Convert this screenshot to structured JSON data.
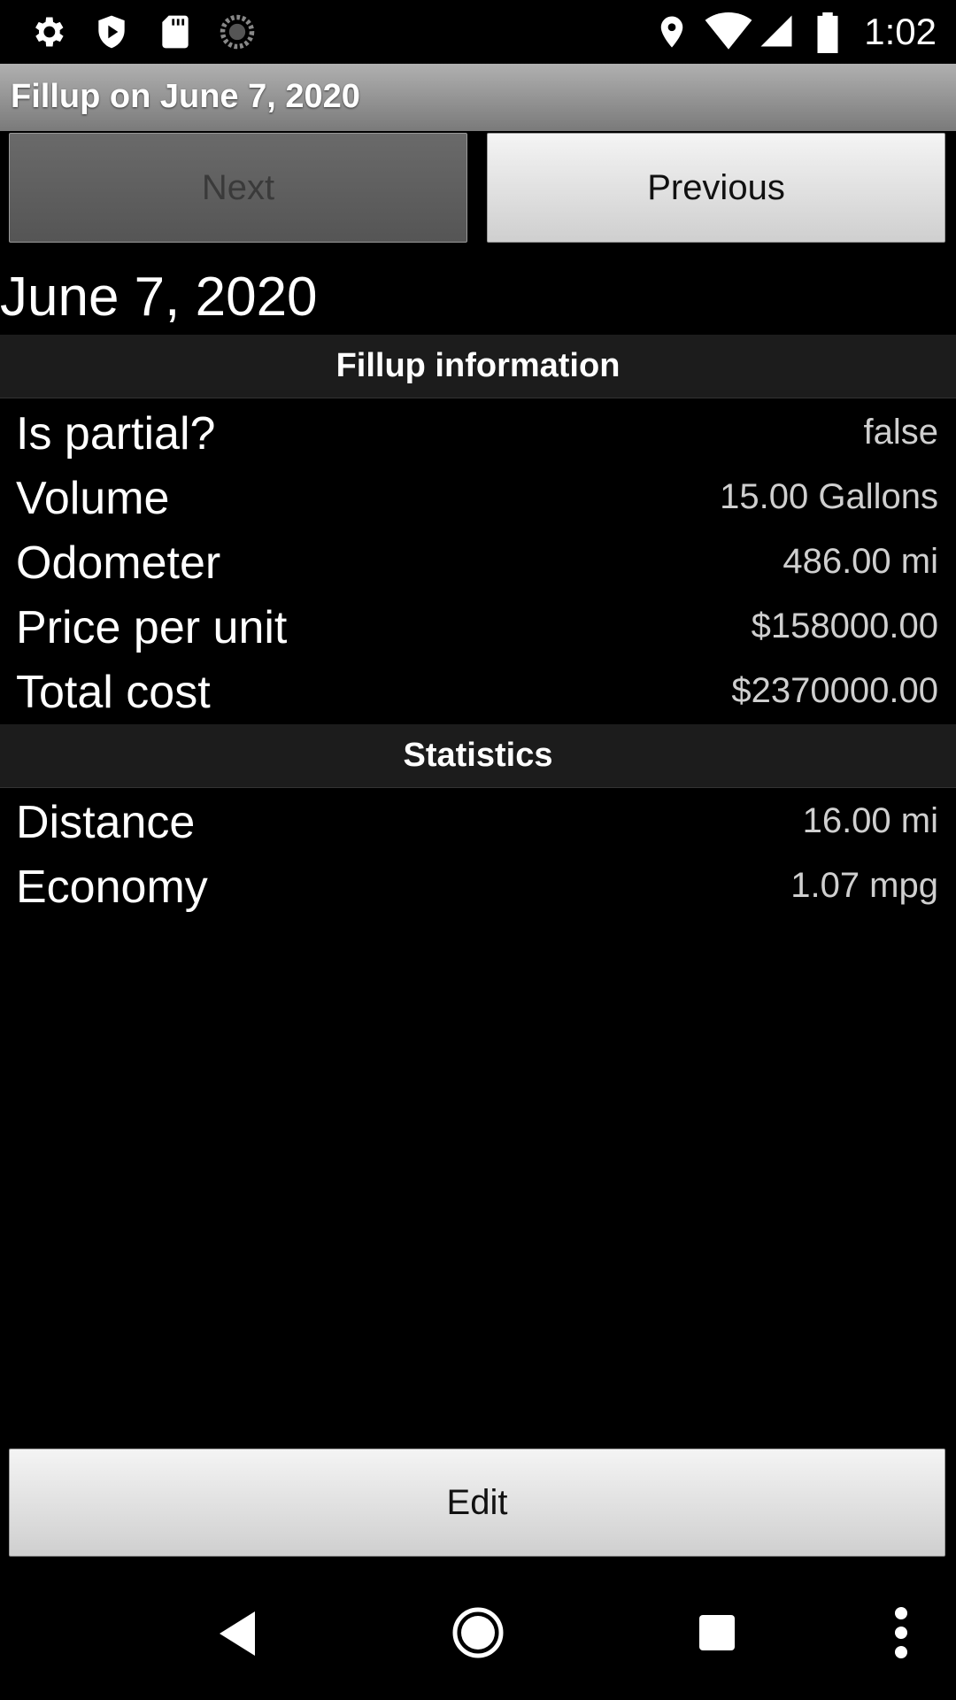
{
  "status_bar": {
    "time": "1:02",
    "left_icons": [
      "settings-icon",
      "shield-play-icon",
      "sd-card-icon",
      "sync-progress-icon"
    ],
    "right_icons": [
      "location-icon",
      "wifi-icon",
      "signal-icon",
      "battery-icon"
    ]
  },
  "title_bar": {
    "title": "Fillup on June 7, 2020"
  },
  "navigation": {
    "next_label": "Next",
    "previous_label": "Previous"
  },
  "date_heading": "June 7, 2020",
  "fillup_section": {
    "header": "Fillup information",
    "rows": [
      {
        "label": "Is partial?",
        "value": "false"
      },
      {
        "label": "Volume",
        "value": "15.00 Gallons"
      },
      {
        "label": "Odometer",
        "value": "486.00 mi"
      },
      {
        "label": "Price per unit",
        "value": "$158000.00"
      },
      {
        "label": "Total cost",
        "value": "$2370000.00"
      }
    ]
  },
  "statistics_section": {
    "header": "Statistics",
    "rows": [
      {
        "label": "Distance",
        "value": "16.00 mi"
      },
      {
        "label": "Economy",
        "value": "1.07 mpg"
      }
    ]
  },
  "edit_button": {
    "label": "Edit"
  },
  "system_nav": [
    "back-icon",
    "home-icon",
    "recents-icon",
    "overflow-menu-icon"
  ]
}
